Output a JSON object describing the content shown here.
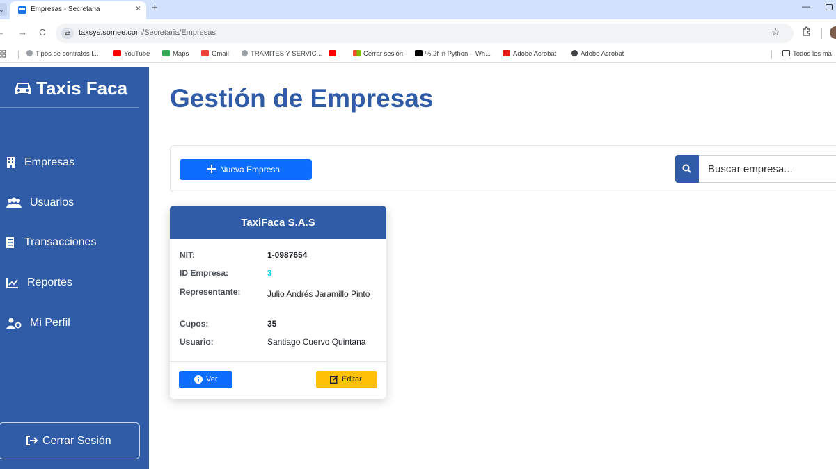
{
  "browser": {
    "tab_menu_glyph": "⌄",
    "tab_title": "Empresas - Secretaria",
    "tab_close": "×",
    "new_tab": "+",
    "minimize": "—",
    "back": "←",
    "forward": "→",
    "reload": "C",
    "site_info": "⇄",
    "url_host": "taxsys.somee.com",
    "url_path": "/Secretaria/Empresas",
    "star": "☆",
    "bookmarks": [
      {
        "label": "Tipos de contratos l...",
        "icon": "globe-icon",
        "color": "#9aa0a6"
      },
      {
        "label": "YouTube",
        "icon": "youtube-icon",
        "color": "#ff0000"
      },
      {
        "label": "Maps",
        "icon": "maps-icon",
        "color": "#34a853"
      },
      {
        "label": "Gmail",
        "icon": "gmail-icon",
        "color": "#ea4335"
      },
      {
        "label": "TRAMITES Y SERVIC...",
        "icon": "globe-icon",
        "color": "#9aa0a6"
      },
      {
        "label": "",
        "icon": "youtube-icon",
        "color": "#ff0000"
      },
      {
        "label": "Cerrar sesión",
        "icon": "microsoft-icon",
        "color": "#f25022"
      },
      {
        "label": "%.2f in Python – Wh...",
        "icon": "python-icon",
        "color": "#000000"
      },
      {
        "label": "Adobe Acrobat",
        "icon": "acrobat-icon",
        "color": "#e21b1b"
      },
      {
        "label": "Adobe Acrobat",
        "icon": "globe-icon",
        "color": "#3c4043"
      }
    ],
    "all_bookmarks_label": "Todos los ma"
  },
  "sidebar": {
    "brand": "Taxis Faca",
    "items": [
      {
        "label": "Empresas",
        "icon": "building-icon"
      },
      {
        "label": "Usuarios",
        "icon": "users-icon"
      },
      {
        "label": "Transacciones",
        "icon": "receipt-icon"
      },
      {
        "label": "Reportes",
        "icon": "chart-line-icon"
      },
      {
        "label": "Mi Perfil",
        "icon": "user-cog-icon"
      }
    ],
    "logout_label": "Cerrar Sesión"
  },
  "main": {
    "title": "Gestión de Empresas",
    "new_button_label": "Nueva Empresa",
    "search_placeholder": "Buscar empresa..."
  },
  "company": {
    "name": "TaxiFaca S.A.S",
    "fields": [
      {
        "label": "NIT:",
        "value": "1-0987654"
      },
      {
        "label": "ID Empresa:",
        "value": "3"
      },
      {
        "label": "Representante:",
        "value": "Julio Andrés Jaramillo Pinto"
      },
      {
        "label": "Cupos:",
        "value": "35"
      },
      {
        "label": "Usuario:",
        "value": "Santiago Cuervo Quintana"
      }
    ],
    "view_label": "Ver",
    "edit_label": "Editar"
  },
  "colors": {
    "sidebar": "#2f5ba7",
    "primary": "#0d6efd",
    "warning": "#ffc107",
    "info": "#0dcaf0"
  }
}
